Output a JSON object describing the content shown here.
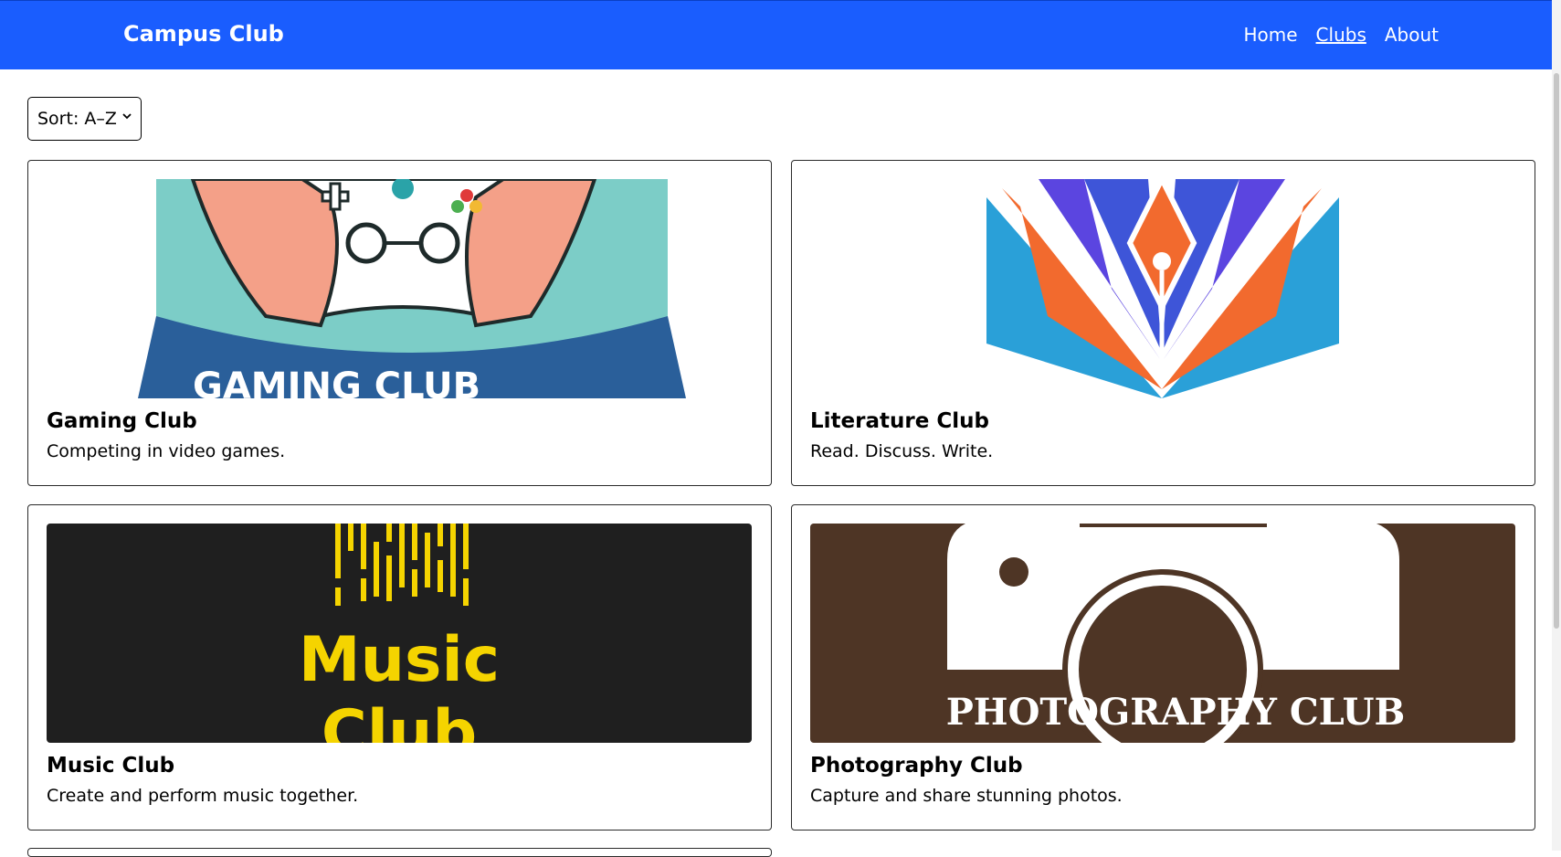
{
  "header": {
    "brand": "Campus Club",
    "nav": [
      {
        "label": "Home",
        "active": false
      },
      {
        "label": "Clubs",
        "active": true
      },
      {
        "label": "About",
        "active": false
      }
    ]
  },
  "controls": {
    "sort_label": "Sort: A–Z"
  },
  "clubs": [
    {
      "title": "Gaming Club",
      "desc": "Competing in video games.",
      "image_text": "GAMING CLUB"
    },
    {
      "title": "Literature Club",
      "desc": "Read. Discuss. Write."
    },
    {
      "title": "Music Club",
      "desc": "Create and perform music together.",
      "image_text_1": "Music",
      "image_text_2": "Club"
    },
    {
      "title": "Photography Club",
      "desc": "Capture and share stunning photos.",
      "image_text": "PHOTOGRAPHY CLUB"
    }
  ],
  "colors": {
    "brand_blue": "#1a5dfe",
    "music_yellow": "#f5d400",
    "photo_brown": "#4e3525"
  }
}
